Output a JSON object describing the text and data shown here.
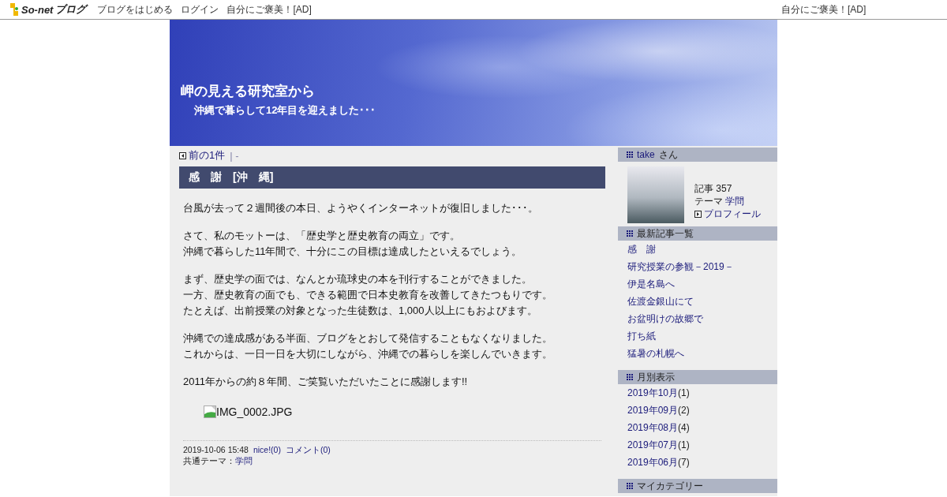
{
  "topbar": {
    "logo": "So-net",
    "logo_suffix": "ブログ",
    "links": [
      "ブログをはじめる",
      "ログイン",
      "自分にご褒美！[AD]"
    ],
    "right_ad": "自分にご褒美！[AD]"
  },
  "header": {
    "title": "岬の見える研究室から",
    "subtitle": "沖縄で暮らして12年目を迎えました･･･"
  },
  "pager": {
    "prev": "前の1件",
    "tail": "| -"
  },
  "article": {
    "title": "感　謝　[沖　縄]",
    "paragraphs": [
      [
        "台風が去って２週間後の本日、ようやくインターネットが復旧しました･･･。"
      ],
      [
        "さて、私のモットーは、「歴史学と歴史教育の両立」です。",
        "沖縄で暮らした11年間で、十分にこの目標は達成したといえるでしょう。"
      ],
      [
        "まず、歴史学の面では、なんとか琉球史の本を刊行することができました。",
        "一方、歴史教育の面でも、できる範囲で日本史教育を改善してきたつもりです。",
        "たとえば、出前授業の対象となった生徒数は、1,000人以上にもおよびます。"
      ],
      [
        "沖縄での達成感がある半面、ブログをとおして発信することもなくなりました。",
        "これからは、一日一日を大切にしながら、沖縄での暮らしを楽しんでいきます。"
      ],
      [
        "2011年からの約８年間、ご笑覧いただいたことに感謝します!!"
      ]
    ],
    "image_alt": "IMG_0002.JPG",
    "date": "2019-10-06 15:48",
    "nice": "nice!(0)",
    "comments": "コメント(0)",
    "theme_label": "共通テーマ：",
    "theme": "学問"
  },
  "sidebar": {
    "profile": {
      "name": "take",
      "suffix": "さん",
      "articles": "記事 357",
      "theme_label": "テーマ",
      "theme": "学問",
      "profile_link": "プロフィール"
    },
    "recent": {
      "title": "最新記事一覧",
      "items": [
        "感　謝",
        "研究授業の参観－2019－",
        "伊是名島へ",
        "佐渡金銀山にて",
        "お盆明けの故郷で",
        "打ち紙",
        "猛暑の札幌へ"
      ]
    },
    "monthly": {
      "title": "月別表示",
      "items": [
        {
          "month": "2019年10月",
          "count": "(1)"
        },
        {
          "month": "2019年09月",
          "count": "(2)"
        },
        {
          "month": "2019年08月",
          "count": "(4)"
        },
        {
          "month": "2019年07月",
          "count": "(1)"
        },
        {
          "month": "2019年06月",
          "count": "(7)"
        }
      ]
    },
    "category": {
      "title": "マイカテゴリー"
    }
  }
}
